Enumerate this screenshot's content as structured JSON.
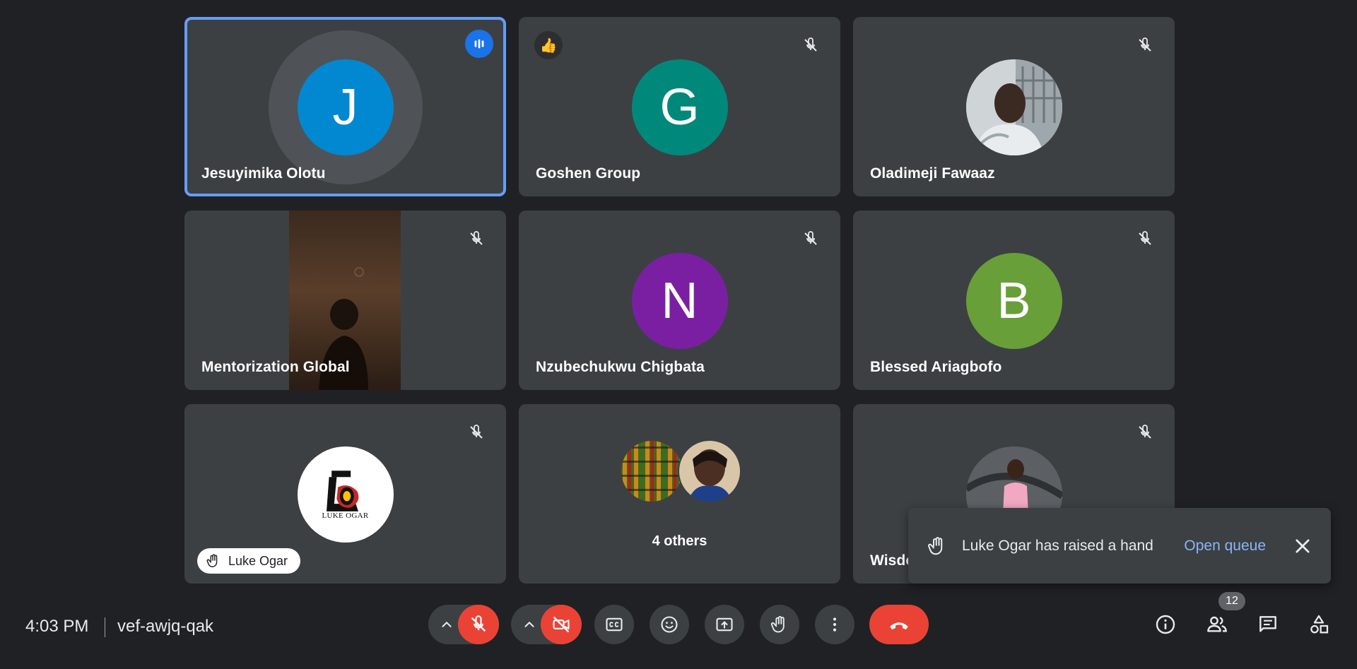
{
  "participants": [
    {
      "name": "Jesuyimika Olotu",
      "initial": "J",
      "avatar_color": "#0288d1"
    },
    {
      "name": "Goshen Group",
      "initial": "G",
      "avatar_color": "#00897b",
      "reaction": "👍"
    },
    {
      "name": "Oladimeji Fawaaz"
    },
    {
      "name": "Mentorization Global"
    },
    {
      "name": "Nzubechukwu Chigbata",
      "initial": "N",
      "avatar_color": "#7b1fa2"
    },
    {
      "name": "Blessed Ariagbofo",
      "initial": "B",
      "avatar_color": "#689f38"
    },
    {
      "name": "Luke Ogar",
      "logo_text": "LUKE OGAR"
    },
    {
      "others_label": "4 others"
    },
    {
      "name": "Wisdo"
    }
  ],
  "toast": {
    "message": "Luke Ogar has raised a hand",
    "action": "Open queue"
  },
  "footer": {
    "time": "4:03 PM",
    "meeting_code": "vef-awjq-qak",
    "people_count": "12"
  },
  "colors": {
    "accent_blue": "#669df6",
    "danger_red": "#ea4335",
    "tile_bg": "#3c4043",
    "page_bg": "#202124"
  }
}
